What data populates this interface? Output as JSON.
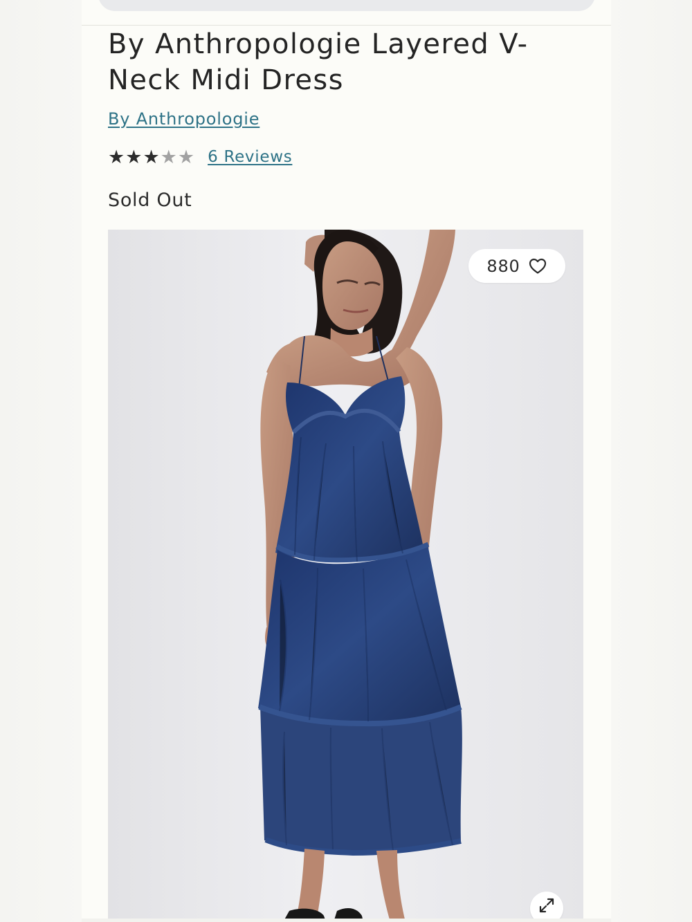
{
  "product": {
    "title": "By Anthropologie Layered V-Neck Midi Dress",
    "brand_link": "By Anthropologie",
    "rating": {
      "value": 3,
      "max": 5,
      "reviews_link": "6 Reviews"
    },
    "stock_status": "Sold Out"
  },
  "gallery": {
    "wishlist_count": "880",
    "heart_icon": "heart-outline-icon",
    "expand_icon": "expand-arrows-icon",
    "image_subject": "model wearing a navy tiered sleeveless midi dress"
  },
  "colors": {
    "link": "#2d7286",
    "dress": "#263f74",
    "text": "#242424",
    "image_background": "#ebebee"
  }
}
